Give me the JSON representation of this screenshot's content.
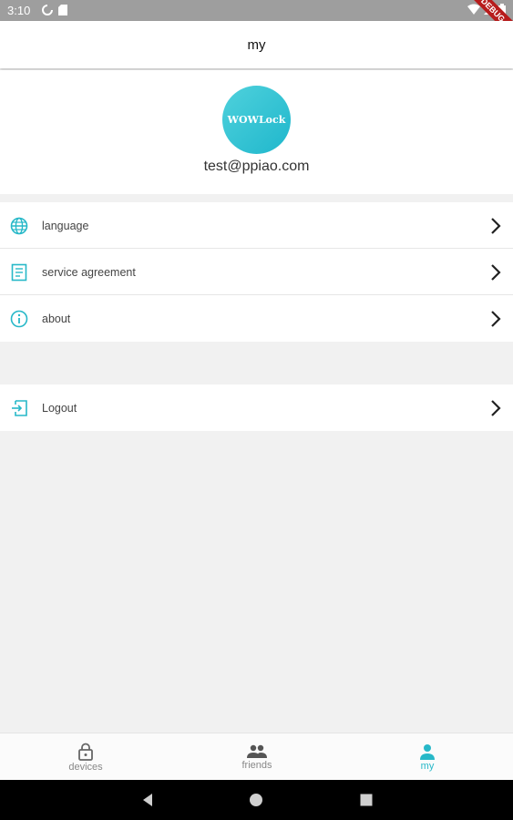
{
  "status_bar": {
    "time": "3:10",
    "debug_banner": "DEBUG"
  },
  "app_bar": {
    "title": "my"
  },
  "profile": {
    "avatar_text": "WOWLock",
    "email": "test@ppiao.com"
  },
  "menu": {
    "items": [
      {
        "label": "language",
        "icon": "globe-icon"
      },
      {
        "label": "service agreement",
        "icon": "document-icon"
      },
      {
        "label": "about",
        "icon": "info-icon"
      }
    ],
    "logout": {
      "label": "Logout",
      "icon": "logout-icon"
    }
  },
  "bottom_nav": {
    "items": [
      {
        "label": "devices",
        "icon": "lock-icon"
      },
      {
        "label": "friends",
        "icon": "people-icon"
      },
      {
        "label": "my",
        "icon": "person-icon"
      }
    ],
    "active": "my"
  },
  "colors": {
    "accent": "#27b8c8",
    "avatar": "#2cc0d0",
    "background": "#f1f1f1"
  }
}
